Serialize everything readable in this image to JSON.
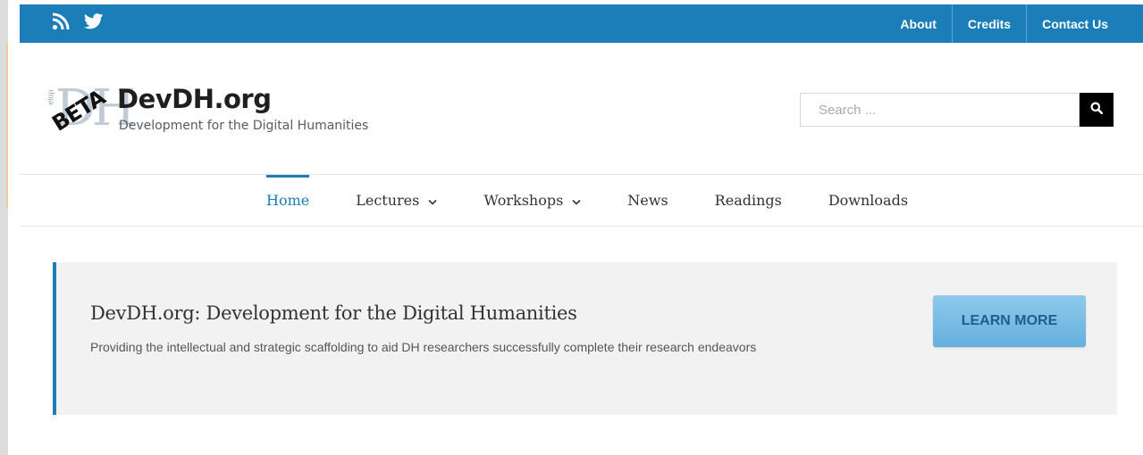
{
  "topbar": {
    "social_icons": [
      "rss-icon",
      "twitter-icon"
    ],
    "links": [
      "About",
      "Credits",
      "Contact Us"
    ]
  },
  "logo": {
    "small_text": "elop",
    "dh_text": "DH",
    "badge": "BETA",
    "title": "DevDH.org",
    "tagline": "Development for the Digital Humanities"
  },
  "search": {
    "placeholder": "Search ...",
    "icon": "search-icon"
  },
  "nav": {
    "items": [
      {
        "label": "Home",
        "active": true
      },
      {
        "label": "Lectures",
        "dropdown": true
      },
      {
        "label": "Workshops",
        "dropdown": true
      },
      {
        "label": "News"
      },
      {
        "label": "Readings"
      },
      {
        "label": "Downloads"
      }
    ]
  },
  "promo": {
    "title": "DevDH.org: Development for the Digital Humanities",
    "subtitle": "Providing the intellectual and strategic scaffolding to aid DH researchers successfully complete their research endeavors",
    "button": "LEARN MORE"
  },
  "colors": {
    "accent": "#1b7eb8",
    "button": "#6fb6e0"
  }
}
